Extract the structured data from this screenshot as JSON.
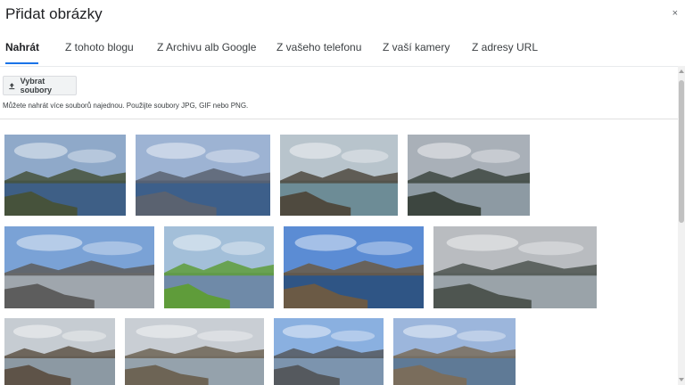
{
  "dialog": {
    "title": "Přidat obrázky",
    "close_symbol": "×"
  },
  "tabs": [
    {
      "label": "Nahrát"
    },
    {
      "label": "Z tohoto blogu"
    },
    {
      "label": "Z Archivu alb Google"
    },
    {
      "label": "Z vašeho telefonu"
    },
    {
      "label": "Z vaší kamery"
    },
    {
      "label": "Z adresy URL"
    }
  ],
  "upload": {
    "button_label": "Vybrat soubory",
    "hint": "Můžete nahrát více souborů najednou. Použijte soubory JPG, GIF nebo PNG."
  },
  "thumbnails": [
    {
      "name": "photo-fjord-islands",
      "sky": "#8fa9c9",
      "land": "#46523b",
      "water": "#3e5f86"
    },
    {
      "name": "photo-sea-mountains",
      "sky": "#9db3d3",
      "land": "#5a6270",
      "water": "#3d5f8a"
    },
    {
      "name": "photo-rocky-shore-waves",
      "sky": "#b8c4cc",
      "land": "#4f4a3f",
      "water": "#6d8c96"
    },
    {
      "name": "photo-bridge-distant",
      "sky": "#a9b0b8",
      "land": "#3d4640",
      "water": "#8d9aa3"
    },
    {
      "name": "photo-road-to-bridge",
      "sky": "#7aa2d6",
      "land": "#5d5d5d",
      "water": "#9fa6ad"
    },
    {
      "name": "photo-bridge-meadow",
      "sky": "#a3bfd9",
      "land": "#5f9c3a",
      "water": "#6f8aa8"
    },
    {
      "name": "photo-bridge-cliffs",
      "sky": "#5b8cd4",
      "land": "#6b5a45",
      "water": "#2f5585"
    },
    {
      "name": "photo-bridge-overcast",
      "sky": "#b9bcc0",
      "land": "#4e5550",
      "water": "#9aa3a9"
    },
    {
      "name": "photo-bridge-arch-1",
      "sky": "#c6ccd2",
      "land": "#5e5348",
      "water": "#8c99a3"
    },
    {
      "name": "photo-bridge-arch-2",
      "sky": "#c9ced4",
      "land": "#6d6455",
      "water": "#95a2ac"
    },
    {
      "name": "photo-flag-monument",
      "sky": "#8ab0e0",
      "land": "#55595e",
      "water": "#7c94ae"
    },
    {
      "name": "photo-coastal-town",
      "sky": "#9cb6dc",
      "land": "#7a6d5c",
      "water": "#5f7a96"
    }
  ]
}
